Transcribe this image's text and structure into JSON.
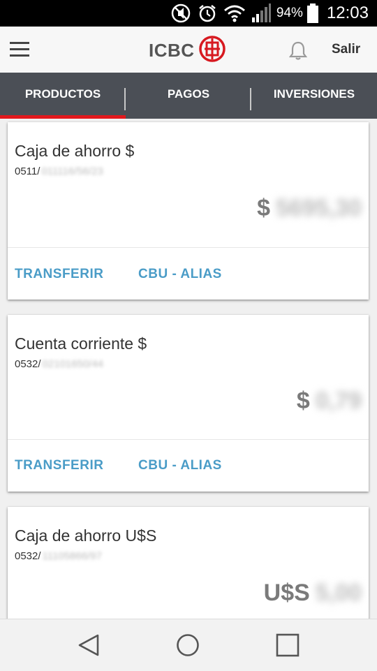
{
  "status_bar": {
    "icons": [
      "mute-icon",
      "alarm-icon",
      "wifi-icon",
      "signal-icon"
    ],
    "battery_percent": "94%",
    "time": "12:03"
  },
  "app_bar": {
    "logo_text": "ICBC",
    "logout_label": "Salir"
  },
  "tabs": [
    {
      "label": "PRODUCTOS",
      "active": true
    },
    {
      "label": "PAGOS",
      "active": false
    },
    {
      "label": "INVERSIONES",
      "active": false
    }
  ],
  "accounts": [
    {
      "title": "Caja de ahorro $",
      "number_prefix": "0511/",
      "number_masked": "011116/56/23",
      "currency": "$",
      "balance_masked": "5695,30",
      "actions": [
        "TRANSFERIR",
        "CBU - ALIAS"
      ]
    },
    {
      "title": "Cuenta corriente $",
      "number_prefix": "0532/",
      "number_masked": "02101650/44",
      "currency": "$",
      "balance_masked": "0,79",
      "actions": [
        "TRANSFERIR",
        "CBU - ALIAS"
      ]
    },
    {
      "title": "Caja de ahorro U$S",
      "number_prefix": "0532/",
      "number_masked": "11105866/97",
      "currency": "U$S",
      "balance_masked": "5,00",
      "actions": []
    }
  ],
  "colors": {
    "tab_bar": "#4b4f56",
    "active_indicator": "#e2181c",
    "link": "#4a9cc7",
    "brand_red": "#d71920"
  }
}
